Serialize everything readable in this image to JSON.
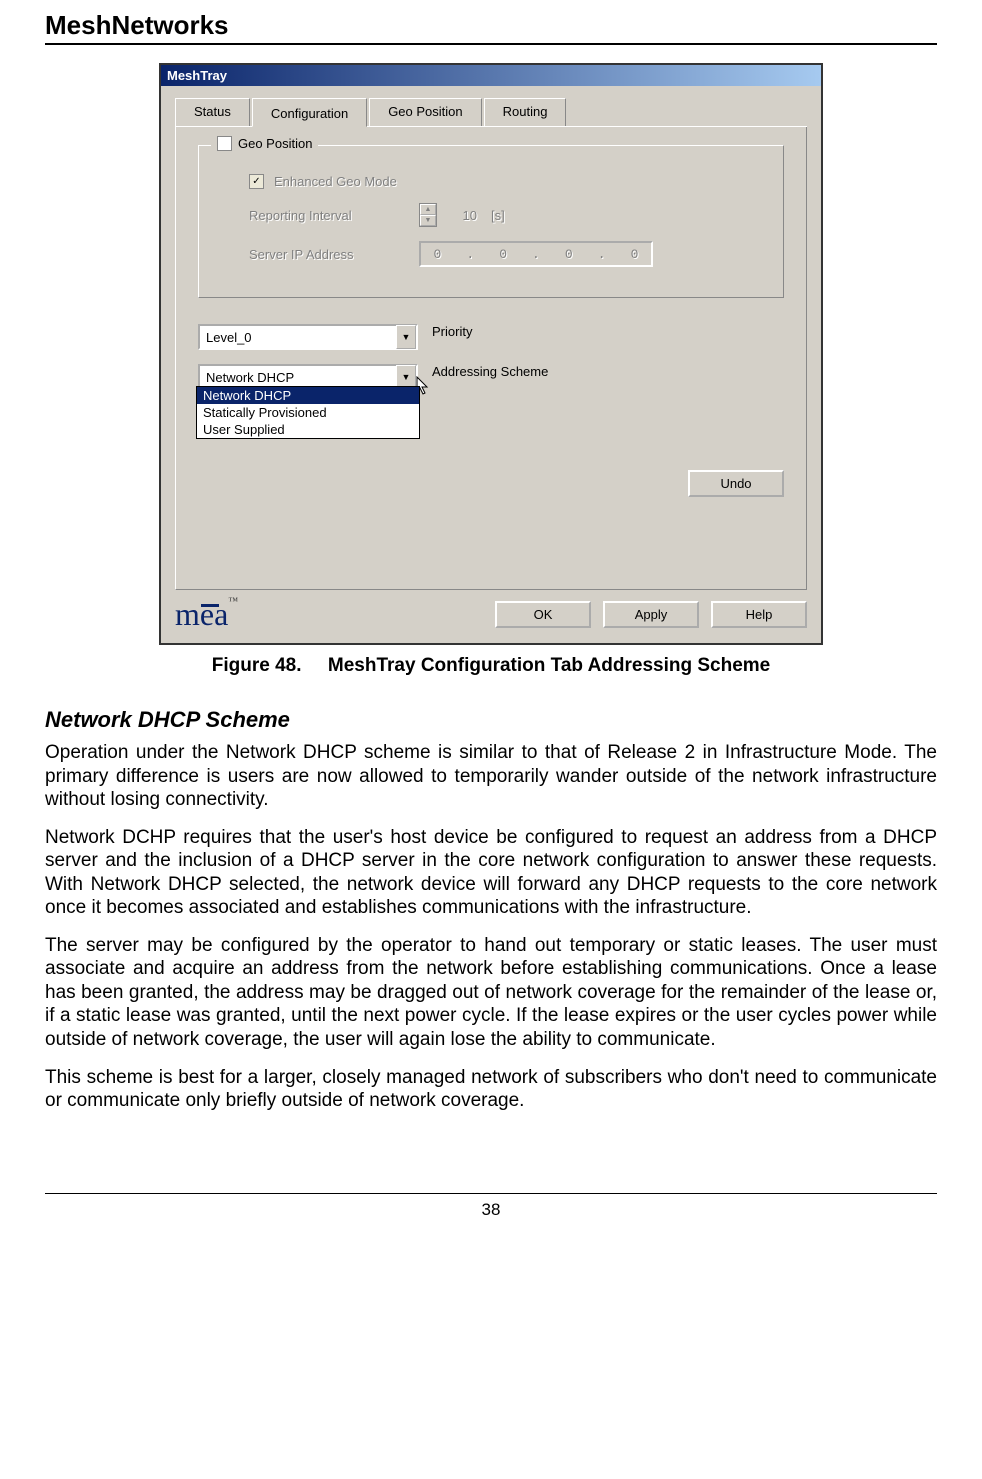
{
  "doc": {
    "header": "MeshNetworks",
    "page_number": "38",
    "figure_caption_prefix": "Figure 48.",
    "figure_caption_text": "MeshTray Configuration Tab Addressing Scheme",
    "section_heading": "Network DHCP Scheme",
    "paragraphs": [
      "Operation under the Network DHCP scheme is similar to that of Release 2 in  Infrastructure Mode.  The primary difference is users are now allowed to temporarily wander outside of the network infrastructure without losing connectivity.",
      "Network DCHP requires that the user's host device be configured to request an address from a DHCP server and the inclusion of a DHCP server in the core network configuration to answer these requests.  With Network DHCP selected, the network device will forward any DHCP requests to the core network once it becomes associated and establishes communications with the infrastructure.",
      "The server may be configured by the operator to hand out temporary or static leases.  The user must associate and acquire an address from the network before establishing communications.  Once a lease has been granted, the address may be dragged out of network coverage for the remainder of the lease or, if a static lease was granted, until the next power cycle.  If the lease expires or the user cycles power while outside of network coverage, the user will again lose the ability to communicate.",
      "This scheme is best for a larger, closely managed network of subscribers who don't need to communicate or communicate only briefly outside of network coverage."
    ]
  },
  "app": {
    "title": "MeshTray",
    "tabs": [
      "Status",
      "Configuration",
      "Geo Position",
      "Routing"
    ],
    "active_tab_index": 1,
    "geo_fieldset": {
      "legend": "Geo Position",
      "enhanced_label": "Enhanced Geo Mode",
      "enhanced_checked": true,
      "reporting_label": "Reporting Interval",
      "reporting_value": "10",
      "reporting_unit": "[s]",
      "server_ip_label": "Server IP Address",
      "server_ip_parts": [
        "0",
        "0",
        "0",
        "0"
      ]
    },
    "priority": {
      "selected": "Level_0",
      "label": "Priority"
    },
    "addressing": {
      "selected": "Network DHCP",
      "label": "Addressing Scheme",
      "options": [
        "Network DHCP",
        "Statically Provisioned",
        "User Supplied"
      ],
      "highlighted_index": 0
    },
    "buttons": {
      "undo": "Undo",
      "ok": "OK",
      "apply": "Apply",
      "help": "Help"
    },
    "logo_text": "mea",
    "logo_tm": "™"
  }
}
